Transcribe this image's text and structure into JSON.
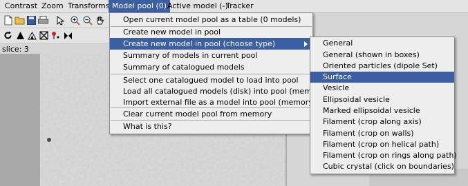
{
  "menubar": {
    "contrast": "Contrast",
    "zoom": "Zoom",
    "transforms": "Transforms",
    "model_pool": "Model pool (0)",
    "active_model": "Active model (-)",
    "tracker": "Tracker"
  },
  "toolbar": {
    "row1_icons": [
      "new-file-icon",
      "open-folder-icon",
      "save-icon",
      "print-icon",
      "pointer-icon",
      "zoom-in-icon",
      "zoom-out-icon",
      "pan-hand-icon"
    ],
    "row2_icons": [
      "reset-view-icon",
      "contrast-stretch-icon",
      "mask-icon",
      "fit-icon",
      "marker-icon",
      "flip-icon"
    ]
  },
  "viewer": {
    "slice_label": "slice: 3"
  },
  "model_pool_menu": {
    "items": [
      "Open current model pool as a table (0 models)",
      "Create new model in pool",
      "Create new model in pool (choose type)",
      "Summary of models in current pool",
      "Summary of catalogued models",
      "Select one catalogued model to load into pool",
      "Load all catalogued models (disk) into pool (memory)",
      "Import external file as a model into pool (memory)",
      "Clear current model pool from memory",
      "What is this?"
    ]
  },
  "choose_type_submenu": {
    "items": [
      "General",
      "General (shown in boxes)",
      "Oriented particles (dipole Set)",
      "Surface",
      "Vesicle",
      "Ellipsoidal vesicle",
      "Marked ellipsoidal vesicle",
      "Filament (crop along axis)",
      "Filament (crop on walls)",
      "Filament (crop on helical path)",
      "Filament (crop on rings along path)",
      "Cubic crystal (click on boundaries)"
    ],
    "highlighted": "Surface"
  },
  "colors": {
    "highlight": "#3c5fa3",
    "menu_bg": "#eeeeee",
    "bar_bg": "#e4e4e4"
  }
}
